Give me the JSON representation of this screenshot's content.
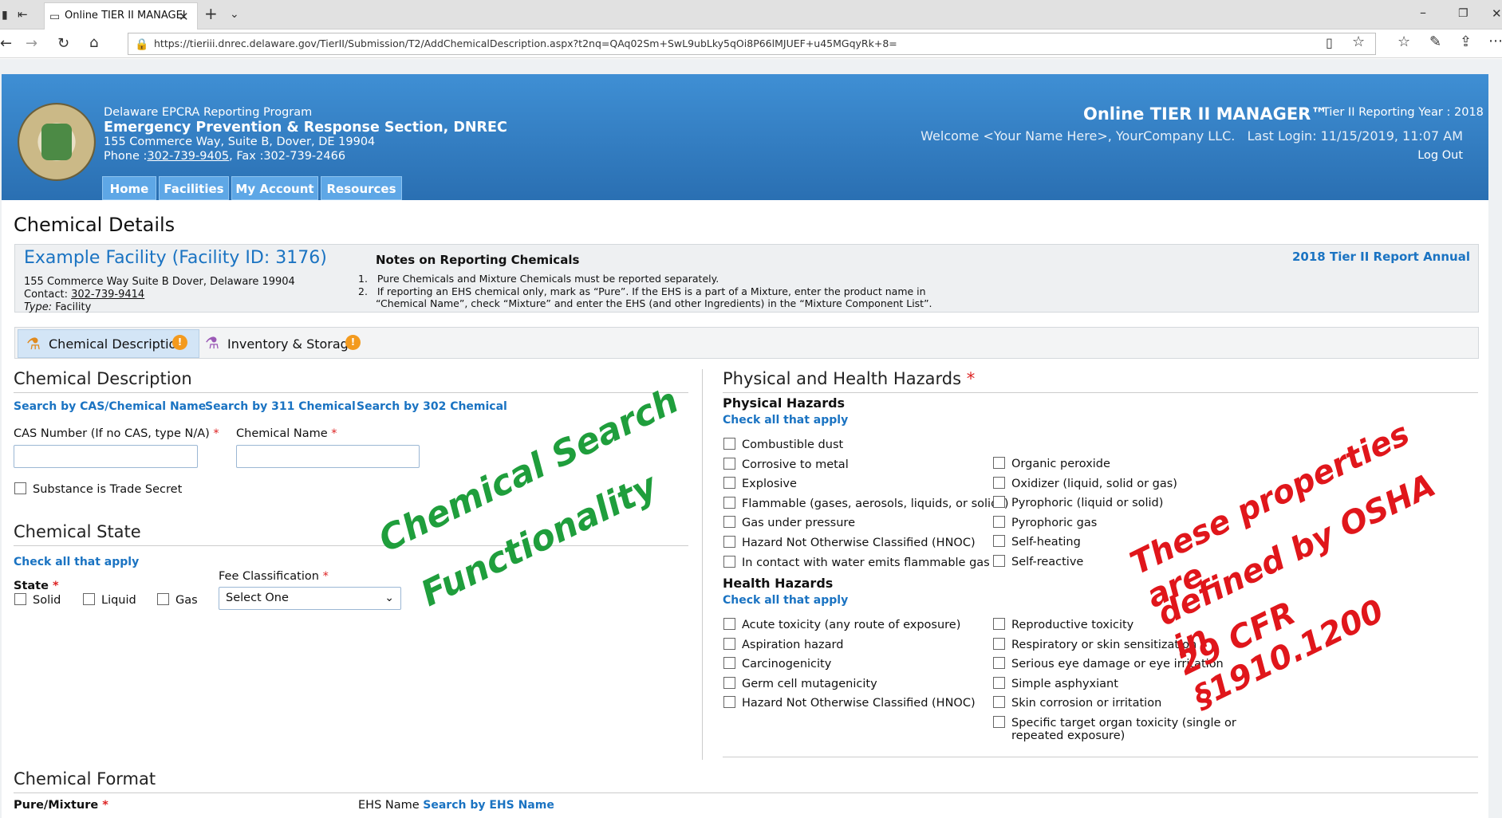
{
  "browser": {
    "tab_title": "Online TIER II MANAGEI",
    "url": "https://tieriii.dnrec.delaware.gov/TierII/Submission/T2/AddChemicalDescription.aspx?t2nq=QAq02Sm+SwL9ubLky5qOi8P66lMJUEF+u45MGqyRk+8="
  },
  "header": {
    "program": "Delaware EPCRA Reporting Program",
    "section": "Emergency Prevention & Response Section, DNREC",
    "address": "155 Commerce Way, Suite B, Dover, DE 19904",
    "phone_prefix": "Phone :",
    "phone": "302-739-9405",
    "fax": ", Fax :302-739-2466",
    "app_title": "Online TIER II MANAGER™",
    "reporting_year": "Tier II Reporting Year : 2018",
    "welcome": "Welcome <Your Name Here>, YourCompany LLC.   Last Login: 11/15/2019, 11:07 AM",
    "logout": "Log Out"
  },
  "nav": [
    "Home",
    "Facilities",
    "My Account",
    "Resources"
  ],
  "page_title": "Chemical Details",
  "facility": {
    "name": "Example Facility (Facility ID: 3176)",
    "address": "155 Commerce Way Suite B Dover, Delaware 19904",
    "contact_label": "Contact:",
    "contact": "302-739-9414",
    "type_label": "Type:",
    "type": "Facility",
    "report": "2018 Tier II Report Annual"
  },
  "notes": {
    "title": "Notes on Reporting Chemicals",
    "n1": "Pure Chemicals and Mixture Chemicals must be reported separately.",
    "n2a": "If reporting an EHS chemical only, mark as “Pure”. If the EHS is a part of a Mixture, enter the product name in",
    "n2b": "“Chemical Name”, check “Mixture” and enter the EHS (and other Ingredients) in the “Mixture Component List”."
  },
  "tabs": {
    "desc": "Chemical Description",
    "inv": "Inventory & Storage"
  },
  "desc": {
    "title": "Chemical Description",
    "s1": "Search by CAS/Chemical Name",
    "s2": "Search by 311 Chemical",
    "s3": "Search by 302 Chemical",
    "cas": "CAS Number (If no CAS, type N/A)",
    "name": "Chemical Name",
    "trade": "Substance is Trade Secret"
  },
  "state": {
    "title": "Chemical State",
    "check": "Check all that apply",
    "state": "State",
    "solid": "Solid",
    "liquid": "Liquid",
    "gas": "Gas",
    "fee": "Fee Classification",
    "select": "Select One"
  },
  "format": {
    "title": "Chemical Format",
    "pure": "Pure/Mixture",
    "ehs": "EHS Name",
    "ehs_link": "Search by EHS Name"
  },
  "hazards": {
    "title": "Physical and Health Hazards",
    "phys": "Physical Hazards",
    "check": "Check all that apply",
    "health": "Health Hazards",
    "phys_left": [
      "Combustible dust",
      "Corrosive to metal",
      "Explosive",
      "Flammable (gases, aerosols, liquids, or solids)",
      "Gas under pressure",
      "Hazard Not Otherwise Classified (HNOC)",
      "In contact with water emits flammable gas"
    ],
    "phys_right": [
      "Organic peroxide",
      "Oxidizer (liquid, solid or gas)",
      "Pyrophoric (liquid or solid)",
      "Pyrophoric gas",
      "Self-heating",
      "Self-reactive"
    ],
    "health_left": [
      "Acute toxicity (any route of exposure)",
      "Aspiration hazard",
      "Carcinogenicity",
      "Germ cell mutagenicity",
      "Hazard Not Otherwise Classified (HNOC)"
    ],
    "health_right": [
      "Reproductive toxicity",
      "Respiratory or skin sensitization",
      "Serious eye damage or eye irritation",
      "Simple asphyxiant",
      "Skin corrosion or irritation",
      "Specific target organ toxicity (single or",
      "repeated exposure)"
    ]
  },
  "overlay": {
    "green1": "Chemical Search",
    "green2": "Functionality",
    "red1": "These properties are",
    "red2": "defined by OSHA in",
    "red3": "29 CFR §1910.1200",
    "green_color": "#1f9e3c",
    "red_color": "#e0161b"
  }
}
